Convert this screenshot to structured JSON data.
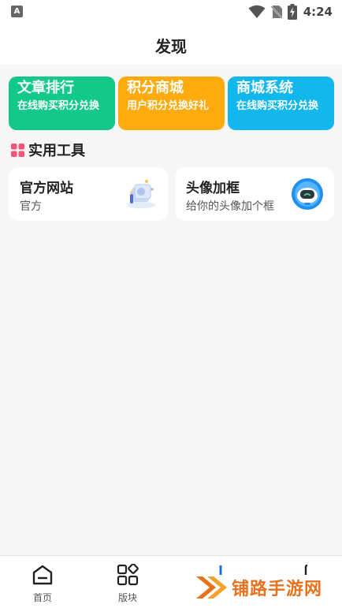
{
  "status_bar": {
    "time": "4:24",
    "left_icon": "a-app-icon",
    "right_icons": [
      "wifi-icon",
      "no-sim-icon",
      "battery-charging-icon"
    ]
  },
  "header": {
    "title": "发现"
  },
  "features": [
    {
      "title": "文章排行",
      "desc": "在线购买积分兑换",
      "color": "#12c98a"
    },
    {
      "title": "积分商城",
      "desc": "用户积分兑换好礼",
      "color": "#ffaa0d"
    },
    {
      "title": "商城系统",
      "desc": "在线购买积分兑换",
      "color": "#12b7ee"
    }
  ],
  "tools_section": {
    "title": "实用工具",
    "icon": "grid-icon",
    "accent": "#f4567a"
  },
  "tools": [
    {
      "title": "官方网站",
      "desc": "官方",
      "icon": "website-illustration-icon"
    },
    {
      "title": "头像加框",
      "desc": "给你的头像加个框",
      "icon": "avatar-robot-icon"
    }
  ],
  "bottom_nav": [
    {
      "label": "首页",
      "icon": "home-icon"
    },
    {
      "label": "版块",
      "icon": "category-grid-icon"
    },
    {
      "label": "",
      "icon": "bookmark-icon"
    },
    {
      "label": "",
      "icon": "user-icon"
    }
  ],
  "watermark": {
    "text": "铺路手游网",
    "color": "#e8711c"
  }
}
